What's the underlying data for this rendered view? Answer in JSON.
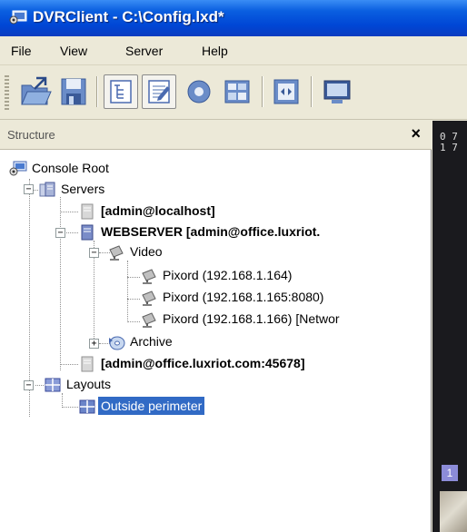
{
  "window": {
    "title": "DVRClient - C:\\Config.lxd*",
    "icon": "dvrclient-app-icon"
  },
  "menu": [
    "File",
    "View",
    "Server",
    "Help"
  ],
  "toolbar": {
    "buttons": [
      {
        "icon": "open-folder-icon",
        "pressed": false
      },
      {
        "icon": "save-icon",
        "pressed": false
      },
      {
        "icon": "structure-view-icon",
        "pressed": true
      },
      {
        "icon": "properties-view-icon",
        "pressed": true
      },
      {
        "icon": "ptz-icon",
        "pressed": false
      },
      {
        "icon": "layout-icon",
        "pressed": false
      },
      {
        "icon": "fullscreen-icon",
        "pressed": false
      },
      {
        "icon": "monitor-icon",
        "pressed": false
      }
    ]
  },
  "panel": {
    "title": "Structure",
    "close": "×"
  },
  "tree": {
    "root": "Console Root",
    "servers": "Servers",
    "server1": "[admin@localhost]",
    "server2": "WEBSERVER [admin@office.luxriot.",
    "video": "Video",
    "cam1": "Pixord (192.168.1.164)",
    "cam2": "Pixord (192.168.1.165:8080)",
    "cam3": "Pixord (192.168.1.166) [Networ",
    "archive": "Archive",
    "server3": "[admin@office.luxriot.com:45678]",
    "layouts": "Layouts",
    "layout1": "Outside perimeter"
  },
  "expanders": {
    "servers": "−",
    "webserver": "−",
    "video": "−",
    "archive": "+",
    "layouts": "−"
  },
  "video": {
    "osd": "0 7\n1 7",
    "camera_number": "1"
  }
}
